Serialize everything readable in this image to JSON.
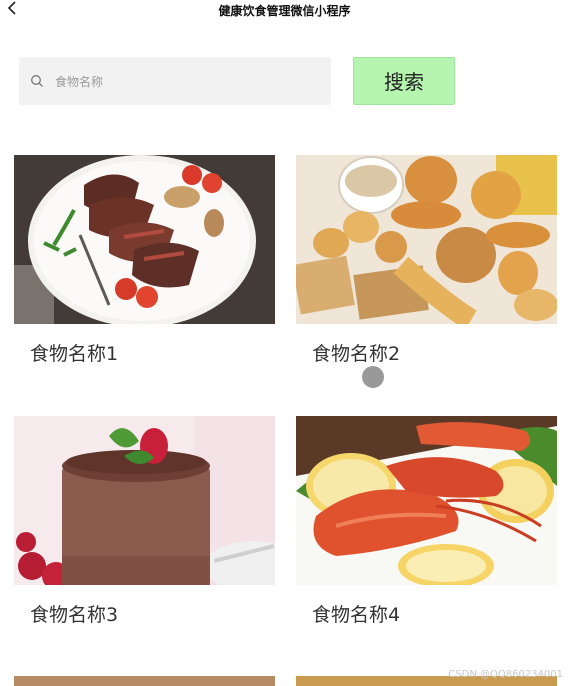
{
  "header": {
    "title": "健康饮食管理微信小程序",
    "back_icon": "chevron-left-icon"
  },
  "search": {
    "placeholder": "食物名称",
    "value": "",
    "button_label": "搜索",
    "button_color": "#b5f5b0"
  },
  "foods": [
    {
      "name": "食物名称1",
      "image": "grilled-steak-plate"
    },
    {
      "name": "食物名称2",
      "image": "bread-assortment"
    },
    {
      "name": "食物名称3",
      "image": "chocolate-cake-raspberries"
    },
    {
      "name": "食物名称4",
      "image": "grilled-prawns-lemon"
    }
  ],
  "watermark": "CSDN @QQ860234001"
}
